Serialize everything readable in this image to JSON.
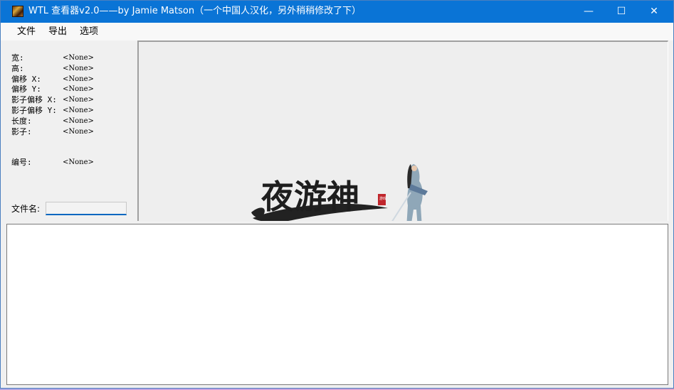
{
  "window": {
    "title": "WTL 查看器v2.0——by Jamie Matson（一个中国人汉化，另外稍稍修改了下）",
    "icon": "app-icon",
    "controls": {
      "minimize": "—",
      "maximize": "☐",
      "close": "✕"
    }
  },
  "menu": {
    "items": [
      "文件",
      "导出",
      "选项"
    ]
  },
  "properties": [
    {
      "label": "宽:",
      "value": "<None>"
    },
    {
      "label": "高:",
      "value": "<None>"
    },
    {
      "label": "偏移 X:",
      "value": "<None>"
    },
    {
      "label": "偏移 Y:",
      "value": "<None>"
    },
    {
      "label": "影子偏移 X:",
      "value": "<None>"
    },
    {
      "label": "影子偏移 Y:",
      "value": "<None>"
    },
    {
      "label": "长度:",
      "value": "<None>"
    },
    {
      "label": "影子:",
      "value": "<None>"
    }
  ],
  "id_field": {
    "label": "编号:",
    "value": "<None>"
  },
  "filename": {
    "label": "文件名:",
    "value": ""
  },
  "preview": {
    "logo_text": "夜游神",
    "seal_text": "游戏"
  },
  "colors": {
    "titlebar": "#0a74d6",
    "window_bg": "#f0f0f0",
    "preview_bg": "#eeeeee",
    "output_bg": "#ffffff",
    "input_accent": "#0067c0"
  }
}
